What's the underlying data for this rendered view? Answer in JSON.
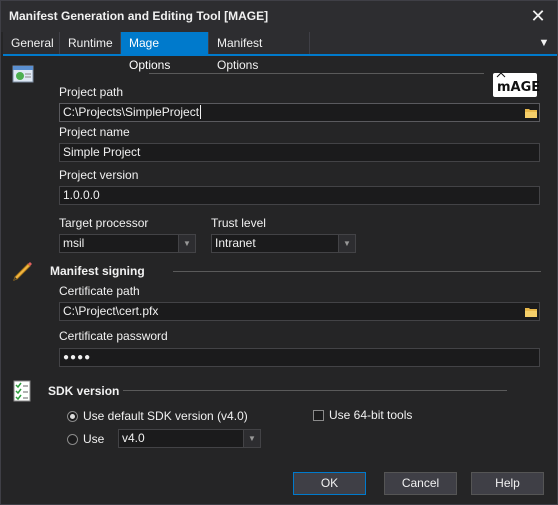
{
  "window": {
    "title": "Manifest Generation and Editing Tool [MAGE]"
  },
  "tabs": [
    {
      "label": "General"
    },
    {
      "label": "Runtime"
    },
    {
      "label": "Mage Options",
      "active": true
    },
    {
      "label": "Manifest Options"
    }
  ],
  "project": {
    "path_label": "Project path",
    "path_value": "C:\\Projects\\SimpleProject",
    "name_label": "Project name",
    "name_value": "Simple Project",
    "version_label": "Project version",
    "version_value": "1.0.0.0",
    "processor_label": "Target processor",
    "processor_value": "msil",
    "trust_label": "Trust level",
    "trust_value": "Intranet"
  },
  "signing": {
    "heading": "Manifest signing",
    "cert_path_label": "Certificate path",
    "cert_path_value": "C:\\Project\\cert.pfx",
    "cert_password_label": "Certificate password",
    "cert_password_value": "●●●●"
  },
  "sdk": {
    "heading": "SDK version",
    "use_default_label": "Use default SDK version (v4.0)",
    "use_default_checked": true,
    "use_label": "Use",
    "use_value": "v4.0",
    "use64_label": "Use 64-bit tools",
    "use64_checked": false
  },
  "buttons": {
    "ok": "OK",
    "cancel": "Cancel",
    "help": "Help"
  },
  "colors": {
    "accent": "#007acc",
    "background": "#252526",
    "input": "#1b1b1c"
  },
  "icons": [
    "close-icon",
    "menu-chevron-icon",
    "project-icon",
    "pencil-icon",
    "sdk-checklist-icon",
    "folder-icon",
    "dropdown-arrow-icon"
  ]
}
